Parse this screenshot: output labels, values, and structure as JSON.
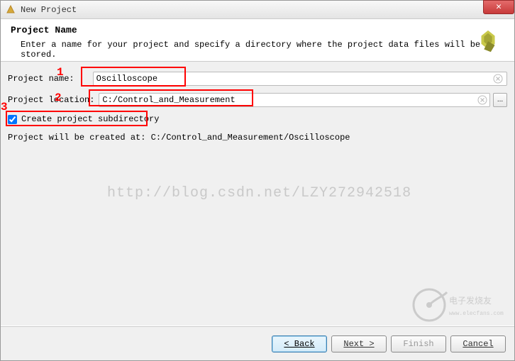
{
  "window": {
    "title": "New Project"
  },
  "header": {
    "title": "Project Name",
    "description": "Enter a name for your project and specify a directory where the project data files will be stored."
  },
  "form": {
    "project_name_label": "Project name:",
    "project_name_value": "Oscilloscope",
    "project_location_label": "Project location:",
    "project_location_value": "C:/Control_and_Measurement",
    "subdir_label": "Create project subdirectory",
    "subdir_checked": true,
    "created_at_text": "Project will be created at: C:/Control_and_Measurement/Oscilloscope",
    "browse_label": "..."
  },
  "annotations": {
    "n1": "1",
    "n2": "2",
    "n3": "3"
  },
  "watermark": "http://blog.csdn.net/LZY272942518",
  "buttons": {
    "back": "< Back",
    "next": "Next >",
    "finish": "Finish",
    "cancel": "Cancel"
  }
}
